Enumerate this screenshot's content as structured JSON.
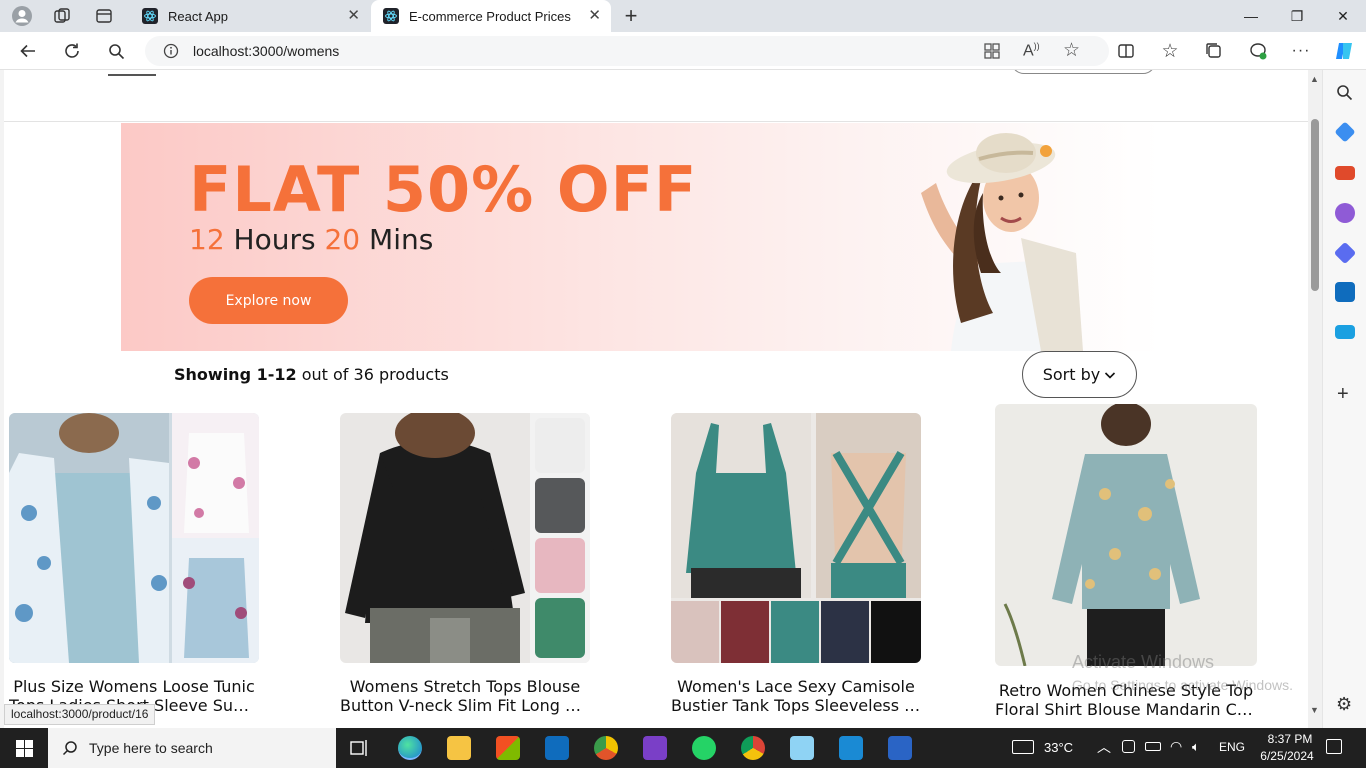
{
  "browser": {
    "tabs": [
      {
        "title": "React App",
        "active": false
      },
      {
        "title": "E-commerce Product Prices",
        "active": true
      }
    ],
    "url": "localhost:3000/womens",
    "new_tab": "+",
    "window_controls": {
      "minimize": "—",
      "restore": "❐",
      "close": "✕"
    }
  },
  "banner": {
    "headline": "FLAT 50% OFF",
    "hours_value": "12",
    "hours_label": "Hours",
    "mins_value": "20",
    "mins_label": "Mins",
    "button_label": "Explore now",
    "accent_color": "#f5713a"
  },
  "listing": {
    "showing_bold": "Showing 1-12",
    "showing_rest": "out of 36 products",
    "sort_label": "Sort by",
    "products": [
      {
        "line1": "Plus Size Womens Loose Tunic",
        "line2": "Tops Ladies Short Sleeve Summe..."
      },
      {
        "line1": "Womens Stretch Tops Blouse",
        "line2": "Button V-neck Slim Fit Long Sleev..."
      },
      {
        "line1": "Women's Lace Sexy Camisole",
        "line2": "Bustier Tank Tops Sleeveless Ves..."
      },
      {
        "line1": "Retro Women Chinese Style Top",
        "line2": "Floral Shirt Blouse Mandarin Coll..."
      }
    ]
  },
  "status_bar": "localhost:3000/product/16",
  "watermark": {
    "line1": "Activate Windows",
    "line2": "Go to Settings to activate Windows."
  },
  "taskbar": {
    "search_placeholder": "Type here to search",
    "temperature": "33°C",
    "language": "ENG",
    "time": "8:37 PM",
    "date": "6/25/2024"
  }
}
